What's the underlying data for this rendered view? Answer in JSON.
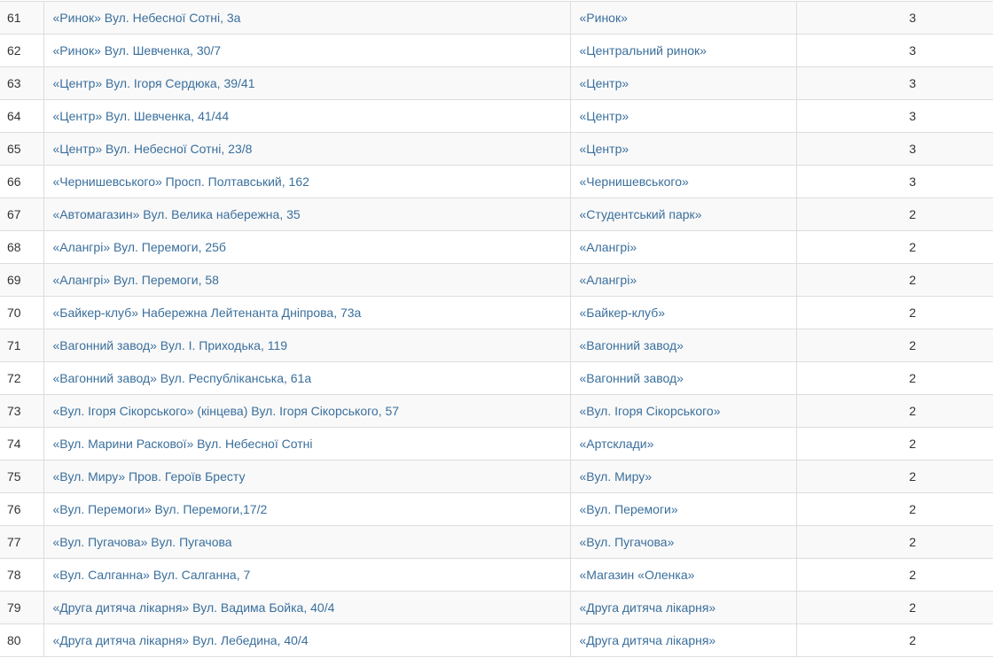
{
  "table": {
    "rows": [
      {
        "num": "61",
        "stop": "«Ринок» Вул. Небесної Сотні, 3а",
        "area": "«Ринок»",
        "count": "3"
      },
      {
        "num": "62",
        "stop": "«Ринок» Вул. Шевченка, 30/7",
        "area": "«Центральний ринок»",
        "count": "3"
      },
      {
        "num": "63",
        "stop": "«Центр» Вул. Ігоря Сердюка, 39/41",
        "area": "«Центр»",
        "count": "3"
      },
      {
        "num": "64",
        "stop": "«Центр» Вул. Шевченка, 41/44",
        "area": "«Центр»",
        "count": "3"
      },
      {
        "num": "65",
        "stop": "«Центр» Вул. Небесної Сотні, 23/8",
        "area": "«Центр»",
        "count": "3"
      },
      {
        "num": "66",
        "stop": "«Чернишевського» Просп. Полтавський, 162",
        "area": "«Чернишевського»",
        "count": "3"
      },
      {
        "num": "67",
        "stop": "«Автомагазин» Вул. Велика набережна, 35",
        "area": "«Студентський парк»",
        "count": "2"
      },
      {
        "num": "68",
        "stop": "«Алангрі» Вул. Перемоги, 25б",
        "area": "«Алангрі»",
        "count": "2"
      },
      {
        "num": "69",
        "stop": "«Алангрі» Вул. Перемоги, 58",
        "area": "«Алангрі»",
        "count": "2"
      },
      {
        "num": "70",
        "stop": "«Байкер-клуб» Набережна Лейтенанта Дніпрова, 73а",
        "area": "«Байкер-клуб»",
        "count": "2"
      },
      {
        "num": "71",
        "stop": "«Вагонний завод» Вул. І. Приходька, 119",
        "area": "«Вагонний завод»",
        "count": "2"
      },
      {
        "num": "72",
        "stop": "«Вагонний завод» Вул. Республіканська, 61а",
        "area": "«Вагонний завод»",
        "count": "2"
      },
      {
        "num": "73",
        "stop": "«Вул. Ігоря Сікорського» (кінцева) Вул. Ігоря Сікорського, 57",
        "area": "«Вул. Ігоря Сікорського»",
        "count": "2"
      },
      {
        "num": "74",
        "stop": "«Вул. Марини Раскової» Вул. Небесної Сотні",
        "area": "«Артсклади»",
        "count": "2"
      },
      {
        "num": "75",
        "stop": "«Вул. Миру» Пров. Героїв Бресту",
        "area": "«Вул. Миру»",
        "count": "2"
      },
      {
        "num": "76",
        "stop": "«Вул. Перемоги» Вул. Перемоги,17/2",
        "area": "«Вул. Перемоги»",
        "count": "2"
      },
      {
        "num": "77",
        "stop": "«Вул. Пугачова» Вул. Пугачова",
        "area": "«Вул. Пугачова»",
        "count": "2"
      },
      {
        "num": "78",
        "stop": "«Вул. Салганна» Вул. Салганна, 7",
        "area": "«Магазин «Оленка»",
        "count": "2"
      },
      {
        "num": "79",
        "stop": "«Друга дитяча лікарня» Вул. Вадима Бойка, 40/4",
        "area": "«Друга дитяча лікарня»",
        "count": "2"
      },
      {
        "num": "80",
        "stop": "«Друга дитяча лікарня» Вул. Лебедина, 40/4",
        "area": "«Друга дитяча лікарня»",
        "count": "2"
      }
    ]
  },
  "colors": {
    "link": "#3a6f9c",
    "text": "#333333",
    "stripe": "#f9f9f9",
    "border": "#dddddd"
  }
}
